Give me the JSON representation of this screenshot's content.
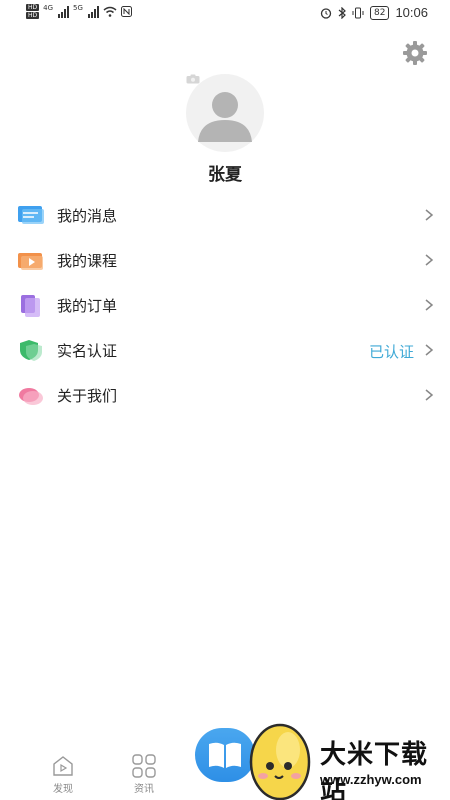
{
  "status_bar": {
    "hd_badges": [
      "HD",
      "HD"
    ],
    "signal_tags": [
      "4G",
      "5G"
    ],
    "battery": "82",
    "time": "10:06"
  },
  "profile": {
    "name": "张夏"
  },
  "menu": {
    "items": [
      {
        "label": "我的消息",
        "icon": "message-icon",
        "color": "#3fa0ef",
        "status": ""
      },
      {
        "label": "我的课程",
        "icon": "course-video-icon",
        "color": "#f2914a",
        "status": ""
      },
      {
        "label": "我的订单",
        "icon": "order-icon",
        "color": "#9b6fe0",
        "status": ""
      },
      {
        "label": "实名认证",
        "icon": "verify-shield-icon",
        "color": "#3cba6a",
        "status": "已认证"
      },
      {
        "label": "关于我们",
        "icon": "about-icon",
        "color": "#f07aa0",
        "status": ""
      }
    ]
  },
  "bottom_nav": {
    "tabs": [
      {
        "label": "发现",
        "icon": "discover-icon"
      },
      {
        "label": "资讯",
        "icon": "news-grid-icon"
      }
    ],
    "center_icon": "book-icon"
  },
  "watermark": {
    "title": "大米下载站",
    "url": "www.zzhyw.com"
  },
  "colors": {
    "accent": "#3fa9d6",
    "nav_center": "#3a9aea"
  }
}
